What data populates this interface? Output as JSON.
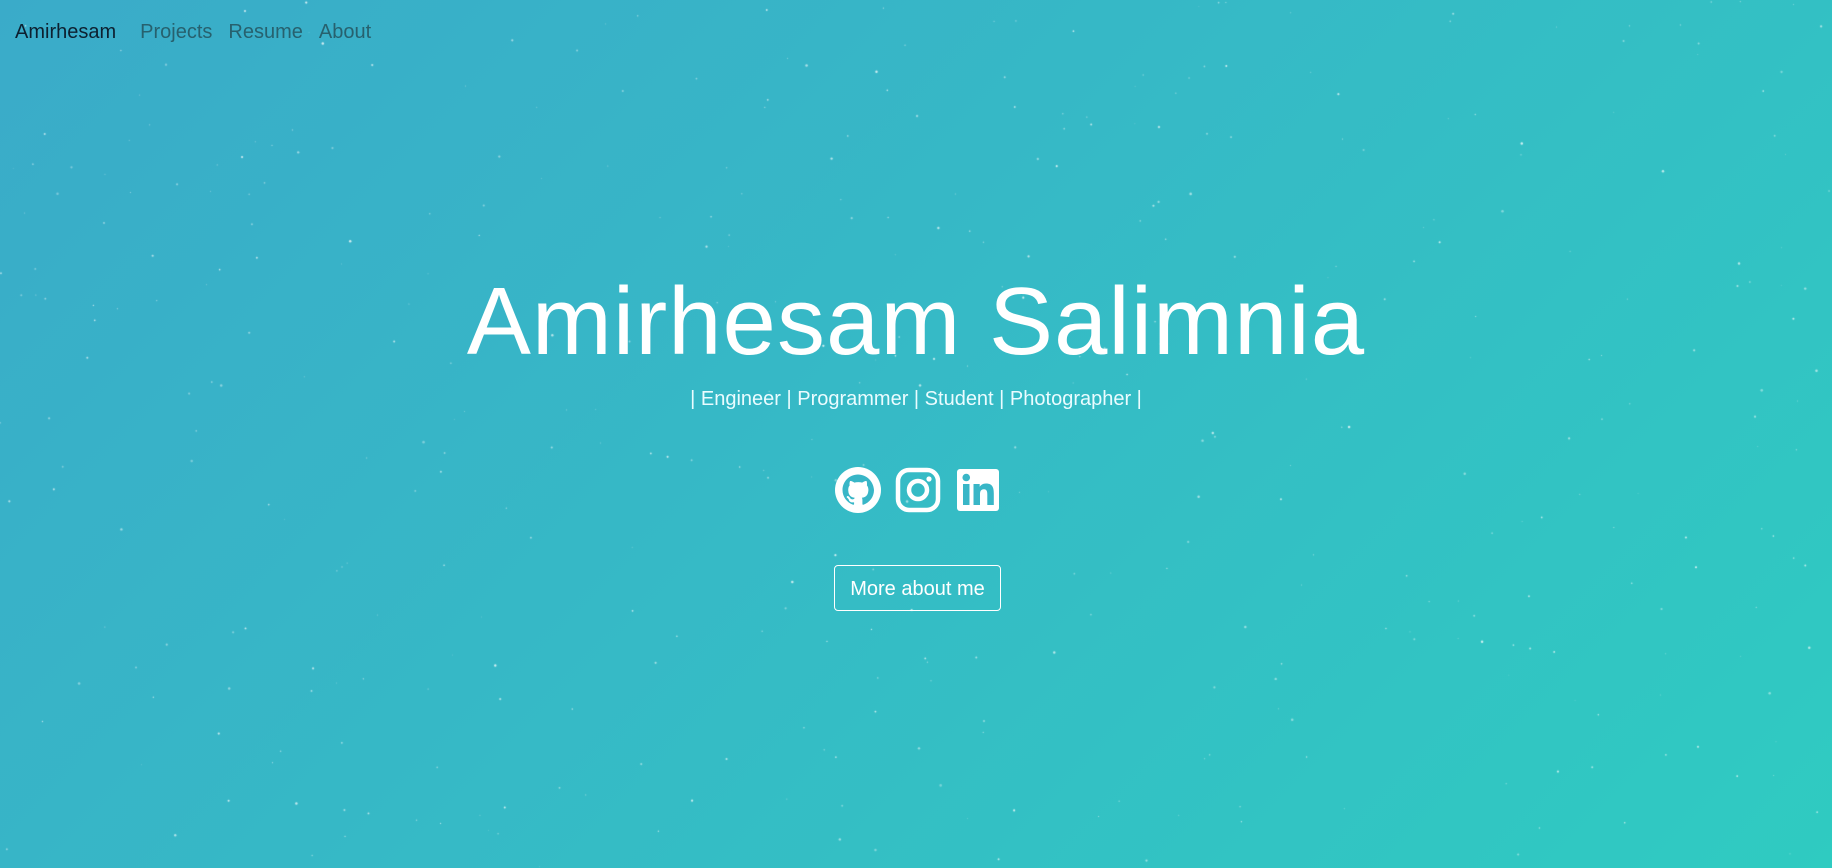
{
  "nav": {
    "brand": "Amirhesam",
    "links": [
      "Projects",
      "Resume",
      "About"
    ]
  },
  "hero": {
    "title": "Amirhesam Salimnia",
    "subtitle": "| Engineer | Programmer | Student | Photographer |",
    "socials": [
      {
        "icon": "github-icon"
      },
      {
        "icon": "instagram-icon"
      },
      {
        "icon": "linkedin-icon"
      }
    ],
    "button_label": "More about me"
  },
  "colors": {
    "gradient_start": "#3aabc9",
    "gradient_end": "#2fcbc1",
    "text": "#ffffff",
    "brand_text": "#0d2030",
    "nav_link": "#27616e"
  }
}
